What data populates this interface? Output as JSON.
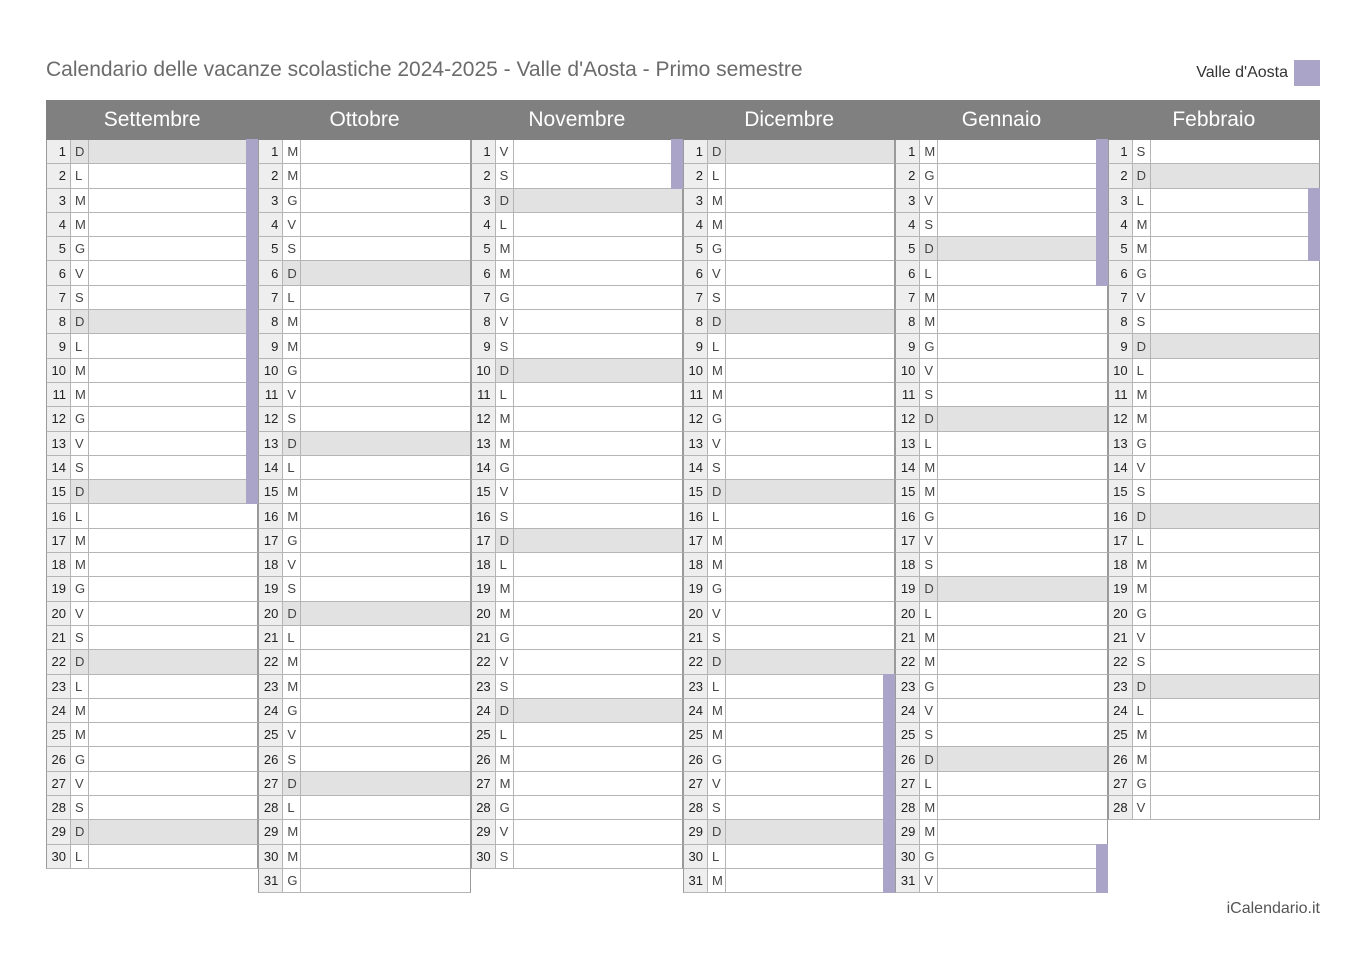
{
  "title": "Calendario delle vacanze scolastiche 2024-2025 - Valle d'Aosta - Primo semestre",
  "legend": {
    "label": "Valle d'Aosta",
    "color": "#a9a4c8"
  },
  "footer": "iCalendario.it",
  "colors": {
    "header_bg": "#808080",
    "weekend_bg": "#e2e2e2",
    "holiday": "#a9a4c8"
  },
  "months": [
    {
      "name": "Settembre",
      "days": [
        "D",
        "L",
        "M",
        "M",
        "G",
        "V",
        "S",
        "D",
        "L",
        "M",
        "M",
        "G",
        "V",
        "S",
        "D",
        "L",
        "M",
        "M",
        "G",
        "V",
        "S",
        "D",
        "L",
        "M",
        "M",
        "G",
        "V",
        "S",
        "D",
        "L"
      ],
      "holidays": [
        1,
        2,
        3,
        4,
        5,
        6,
        7,
        8,
        9,
        10,
        11,
        12,
        13,
        14,
        15
      ]
    },
    {
      "name": "Ottobre",
      "days": [
        "M",
        "M",
        "G",
        "V",
        "S",
        "D",
        "L",
        "M",
        "M",
        "G",
        "V",
        "S",
        "D",
        "L",
        "M",
        "M",
        "G",
        "V",
        "S",
        "D",
        "L",
        "M",
        "M",
        "G",
        "V",
        "S",
        "D",
        "L",
        "M",
        "M",
        "G"
      ],
      "holidays": []
    },
    {
      "name": "Novembre",
      "days": [
        "V",
        "S",
        "D",
        "L",
        "M",
        "M",
        "G",
        "V",
        "S",
        "D",
        "L",
        "M",
        "M",
        "G",
        "V",
        "S",
        "D",
        "L",
        "M",
        "M",
        "G",
        "V",
        "S",
        "D",
        "L",
        "M",
        "M",
        "G",
        "V",
        "S"
      ],
      "holidays": [
        1,
        2
      ]
    },
    {
      "name": "Dicembre",
      "days": [
        "D",
        "L",
        "M",
        "M",
        "G",
        "V",
        "S",
        "D",
        "L",
        "M",
        "M",
        "G",
        "V",
        "S",
        "D",
        "L",
        "M",
        "M",
        "G",
        "V",
        "S",
        "D",
        "L",
        "M",
        "M",
        "G",
        "V",
        "S",
        "D",
        "L",
        "M"
      ],
      "holidays": [
        23,
        24,
        25,
        26,
        27,
        28,
        29,
        30,
        31
      ]
    },
    {
      "name": "Gennaio",
      "days": [
        "M",
        "G",
        "V",
        "S",
        "D",
        "L",
        "M",
        "M",
        "G",
        "V",
        "S",
        "D",
        "L",
        "M",
        "M",
        "G",
        "V",
        "S",
        "D",
        "L",
        "M",
        "M",
        "G",
        "V",
        "S",
        "D",
        "L",
        "M",
        "M",
        "G",
        "V"
      ],
      "holidays": [
        1,
        2,
        3,
        4,
        5,
        6,
        30,
        31
      ]
    },
    {
      "name": "Febbraio",
      "days": [
        "S",
        "D",
        "L",
        "M",
        "M",
        "G",
        "V",
        "S",
        "D",
        "L",
        "M",
        "M",
        "G",
        "V",
        "S",
        "D",
        "L",
        "M",
        "M",
        "G",
        "V",
        "S",
        "D",
        "L",
        "M",
        "M",
        "G",
        "V"
      ],
      "holidays": [
        3,
        4,
        5
      ]
    }
  ]
}
